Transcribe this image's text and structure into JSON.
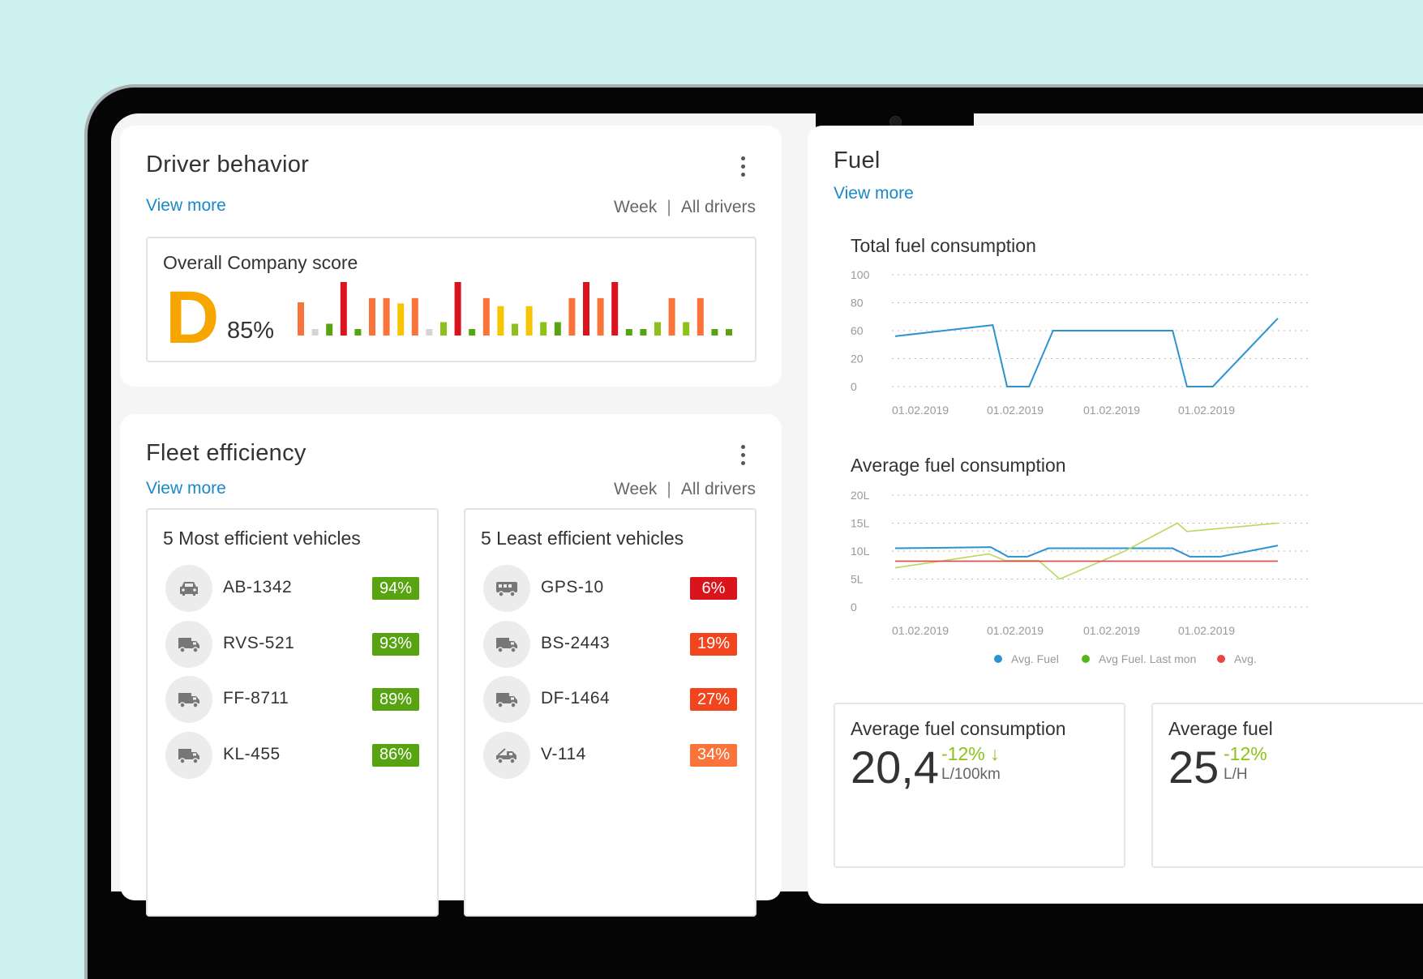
{
  "driver_behavior": {
    "title": "Driver behavior",
    "view_more": "View more",
    "period": "Week",
    "scope": "All drivers",
    "score_box_title": "Overall Company score",
    "grade": "D",
    "percent": "85%",
    "colors": {
      "green": "#57a312",
      "lime": "#8cc21a",
      "yellow": "#f7c400",
      "orange": "#f9733b",
      "red": "#d9141c",
      "gray": "#d4d4d4"
    },
    "score_bars": [
      {
        "value": 0.62,
        "color": "orange"
      },
      {
        "value": 0.12,
        "color": "gray"
      },
      {
        "value": 0.22,
        "color": "green"
      },
      {
        "value": 1.0,
        "color": "red"
      },
      {
        "value": 0.12,
        "color": "green"
      },
      {
        "value": 0.7,
        "color": "orange"
      },
      {
        "value": 0.7,
        "color": "orange"
      },
      {
        "value": 0.6,
        "color": "yellow"
      },
      {
        "value": 0.7,
        "color": "orange"
      },
      {
        "value": 0.12,
        "color": "gray"
      },
      {
        "value": 0.25,
        "color": "lime"
      },
      {
        "value": 1.0,
        "color": "red"
      },
      {
        "value": 0.12,
        "color": "green"
      },
      {
        "value": 0.7,
        "color": "orange"
      },
      {
        "value": 0.55,
        "color": "yellow"
      },
      {
        "value": 0.22,
        "color": "lime"
      },
      {
        "value": 0.55,
        "color": "yellow"
      },
      {
        "value": 0.25,
        "color": "lime"
      },
      {
        "value": 0.25,
        "color": "green"
      },
      {
        "value": 0.7,
        "color": "orange"
      },
      {
        "value": 1.0,
        "color": "red"
      },
      {
        "value": 0.7,
        "color": "orange"
      },
      {
        "value": 1.0,
        "color": "red"
      },
      {
        "value": 0.12,
        "color": "green"
      },
      {
        "value": 0.12,
        "color": "green"
      },
      {
        "value": 0.25,
        "color": "lime"
      },
      {
        "value": 0.7,
        "color": "orange"
      },
      {
        "value": 0.25,
        "color": "lime"
      },
      {
        "value": 0.7,
        "color": "orange"
      },
      {
        "value": 0.12,
        "color": "green"
      },
      {
        "value": 0.12,
        "color": "green"
      }
    ]
  },
  "fleet_efficiency": {
    "title": "Fleet efficiency",
    "view_more": "View more",
    "period": "Week",
    "scope": "All drivers",
    "most": {
      "title": "5 Most efficient vehicles",
      "vehicles": [
        {
          "name": "AB-1342",
          "value": "94%",
          "icon": "car-icon",
          "color": "#57a312"
        },
        {
          "name": "RVS-521",
          "value": "93%",
          "icon": "truck-icon",
          "color": "#57a312"
        },
        {
          "name": "FF-8711",
          "value": "89%",
          "icon": "truck-icon",
          "color": "#57a312"
        },
        {
          "name": "KL-455",
          "value": "86%",
          "icon": "truck-icon",
          "color": "#57a312"
        }
      ]
    },
    "least": {
      "title": "5 Least efficient vehicles",
      "vehicles": [
        {
          "name": "GPS-10",
          "value": "6%",
          "icon": "bus-icon",
          "color": "#d9141c"
        },
        {
          "name": "BS-2443",
          "value": "19%",
          "icon": "truck-icon",
          "color": "#f2451d"
        },
        {
          "name": "DF-1464",
          "value": "27%",
          "icon": "truck-icon",
          "color": "#f2451d"
        },
        {
          "name": "V-114",
          "value": "34%",
          "icon": "tow-truck-icon",
          "color": "#f9733b"
        }
      ]
    }
  },
  "fuel": {
    "title": "Fuel",
    "view_more": "View more",
    "stat_cards": [
      {
        "title": "Average fuel consumption",
        "value": "20,4",
        "delta": "-12% ↓",
        "unit": "L/100km"
      },
      {
        "title": "Average fuel",
        "value": "25",
        "delta": "-12%",
        "unit": "L/H"
      }
    ]
  },
  "chart_data": [
    {
      "type": "line",
      "title": "Total fuel consumption",
      "yticks": [
        "100",
        "80",
        "60",
        "20",
        "0"
      ],
      "xticks": [
        "01.02.2019",
        "01.02.2019",
        "01.02.2019",
        "01.02.2019"
      ],
      "series": [
        {
          "color": "#2b93d1",
          "points": [
            [
              0,
              45
            ],
            [
              1.02,
              55
            ],
            [
              1.17,
              0
            ],
            [
              1.4,
              0
            ],
            [
              1.65,
              50
            ],
            [
              2.9,
              50
            ],
            [
              3.05,
              0
            ],
            [
              3.32,
              0
            ],
            [
              4.0,
              61
            ]
          ]
        }
      ],
      "ylim": [
        0,
        100
      ]
    },
    {
      "type": "line",
      "title": "Average fuel consumption",
      "yticks": [
        "20L",
        "15L",
        "10L",
        "5L",
        "0"
      ],
      "xticks": [
        "01.02.2019",
        "01.02.2019",
        "01.02.2019",
        "01.02.2019"
      ],
      "series": [
        {
          "name": "Avg. Fuel",
          "color": "#2b93d1",
          "points": [
            [
              0,
              10.5
            ],
            [
              1.0,
              10.7
            ],
            [
              1.18,
              9.0
            ],
            [
              1.38,
              9.0
            ],
            [
              1.6,
              10.5
            ],
            [
              2.9,
              10.5
            ],
            [
              3.08,
              9.0
            ],
            [
              3.4,
              9.0
            ],
            [
              4.0,
              11.0
            ]
          ]
        },
        {
          "name": "Avg Fuel. Last mon",
          "color": "#b7d95c",
          "points": [
            [
              0,
              7.0
            ],
            [
              0.98,
              9.5
            ],
            [
              1.15,
              8.3
            ],
            [
              1.5,
              8.3
            ],
            [
              1.72,
              5.0
            ],
            [
              2.4,
              10.0
            ],
            [
              2.95,
              15.0
            ],
            [
              3.05,
              13.5
            ],
            [
              4.0,
              15.0
            ]
          ]
        },
        {
          "name": "Avg.",
          "color": "#e84545",
          "points": [
            [
              0,
              8.2
            ],
            [
              4.0,
              8.2
            ]
          ]
        }
      ],
      "ylim": [
        0,
        20
      ]
    }
  ]
}
